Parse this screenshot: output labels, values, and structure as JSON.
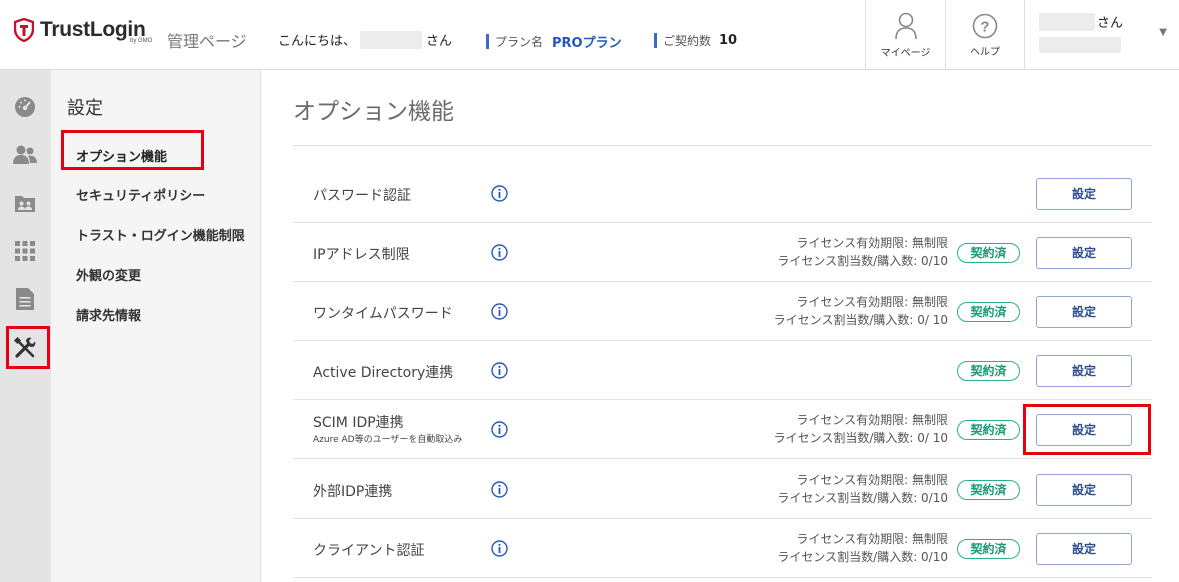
{
  "header": {
    "logo_text": "TrustLogin",
    "logo_sub": "by GMO",
    "admin_label": "管理ページ",
    "greeting_prefix": "こんにちは、",
    "greeting_suffix": "さん",
    "plan_label": "プラン名",
    "plan_value": "PROプラン",
    "contract_label": "ご契約数",
    "contract_value": "10",
    "mypage_label": "マイページ",
    "help_label": "ヘルプ",
    "user_suffix": "さん",
    "mypage_icon": "person-icon",
    "help_icon": "question-circle-icon",
    "dropdown_icon": "caret-down-icon"
  },
  "rail": {
    "icons": [
      "dashboard-icon",
      "users-icon",
      "groups-icon",
      "apps-icon",
      "document-icon",
      "tools-icon"
    ],
    "active": "tools-icon"
  },
  "menu": {
    "title": "設定",
    "items": [
      {
        "label": "オプション機能",
        "active": true
      },
      {
        "label": "セキュリティポリシー"
      },
      {
        "label": "トラスト・ログイン機能制限"
      },
      {
        "label": "外観の変更"
      },
      {
        "label": "請求先情報"
      }
    ]
  },
  "main": {
    "title": "オプション機能",
    "rows": [
      {
        "label": "パスワード認証",
        "button": "設定"
      },
      {
        "label": "IPアドレス制限",
        "lic1": "ライセンス有効期限: 無制限",
        "lic2": "ライセンス割当数/購入数: 0/10",
        "badge": "契約済",
        "button": "設定"
      },
      {
        "label": "ワンタイムパスワード",
        "lic1": "ライセンス有効期限: 無制限",
        "lic2": "ライセンス割当数/購入数: 0/ 10",
        "badge": "契約済",
        "button": "設定"
      },
      {
        "label": "Active Directory連携",
        "badge": "契約済",
        "button": "設定"
      },
      {
        "label": "SCIM IDP連携",
        "sublabel": "Azure AD等のユーザーを自動取込み",
        "lic1": "ライセンス有効期限: 無制限",
        "lic2": "ライセンス割当数/購入数: 0/ 10",
        "badge": "契約済",
        "button": "設定",
        "highlighted": true
      },
      {
        "label": "外部IDP連携",
        "lic1": "ライセンス有効期限: 無制限",
        "lic2": "ライセンス割当数/購入数: 0/10",
        "badge": "契約済",
        "button": "設定"
      },
      {
        "label": "クライアント認証",
        "lic1": "ライセンス有効期限: 無制限",
        "lic2": "ライセンス割当数/購入数: 0/10",
        "badge": "契約済",
        "button": "設定"
      }
    ]
  },
  "colors": {
    "accent_blue": "#2458b8",
    "badge_green": "#1a9a75",
    "highlight_red": "#e60012"
  }
}
